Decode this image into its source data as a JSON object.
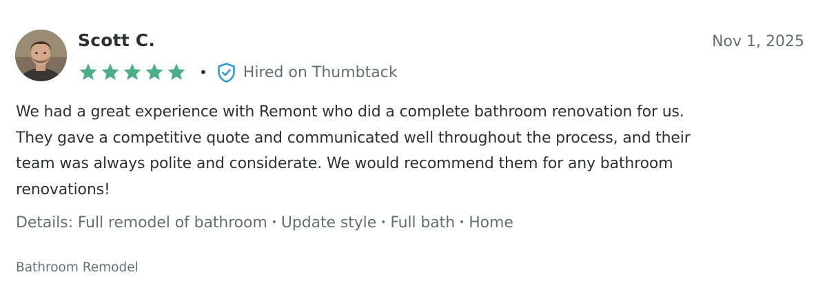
{
  "review": {
    "reviewer_name": "Scott C.",
    "date": "Nov 1, 2025",
    "rating": 5,
    "rating_max": 5,
    "star_color": "#4cae86",
    "separator": "•",
    "hired_label": "Hired on Thumbtack",
    "hired_icon": "shield-check-icon",
    "hired_icon_color": "#2f9bd6",
    "body_lines": [
      "We had a great experience with Remont who did a complete bathroom renovation for us.",
      "They gave a competitive quote and communicated well throughout the process, and their",
      "team was always polite and considerate. We would recommend them for any bathroom",
      "renovations!"
    ],
    "details": {
      "prefix": "Details:",
      "items": [
        "Full remodel of bathroom",
        "Update style",
        "Full bath",
        "Home"
      ],
      "separator": "•"
    },
    "category": "Bathroom Remodel"
  }
}
